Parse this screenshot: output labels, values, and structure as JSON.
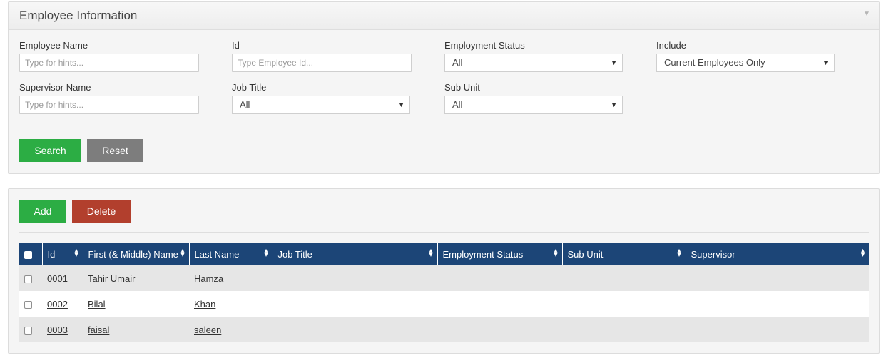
{
  "search_panel": {
    "title": "Employee Information",
    "collapse_icon": "triangle-down",
    "fields": {
      "employee_name": {
        "label": "Employee Name",
        "placeholder": "Type for hints..."
      },
      "id": {
        "label": "Id",
        "placeholder": "Type Employee Id..."
      },
      "employment_status": {
        "label": "Employment Status",
        "value": "All"
      },
      "include": {
        "label": "Include",
        "value": "Current Employees Only"
      },
      "supervisor_name": {
        "label": "Supervisor Name",
        "placeholder": "Type for hints..."
      },
      "job_title": {
        "label": "Job Title",
        "value": "All"
      },
      "sub_unit": {
        "label": "Sub Unit",
        "value": "All"
      }
    },
    "buttons": {
      "search": "Search",
      "reset": "Reset"
    }
  },
  "list_panel": {
    "buttons": {
      "add": "Add",
      "delete": "Delete"
    },
    "columns": [
      "Id",
      "First (& Middle) Name",
      "Last Name",
      "Job Title",
      "Employment Status",
      "Sub Unit",
      "Supervisor"
    ],
    "rows": [
      {
        "id": "0001",
        "first_name": "Tahir Umair",
        "last_name": "Hamza",
        "job_title": "",
        "employment_status": "",
        "sub_unit": "",
        "supervisor": ""
      },
      {
        "id": "0002",
        "first_name": "Bilal",
        "last_name": "Khan",
        "job_title": "",
        "employment_status": "",
        "sub_unit": "",
        "supervisor": ""
      },
      {
        "id": "0003",
        "first_name": "faisal",
        "last_name": "saleen",
        "job_title": "",
        "employment_status": "",
        "sub_unit": "",
        "supervisor": ""
      }
    ]
  },
  "colors": {
    "header_bg": "#1c4577",
    "green": "#2cad44",
    "gray": "#7d7d7d",
    "red": "#b23f2d"
  }
}
